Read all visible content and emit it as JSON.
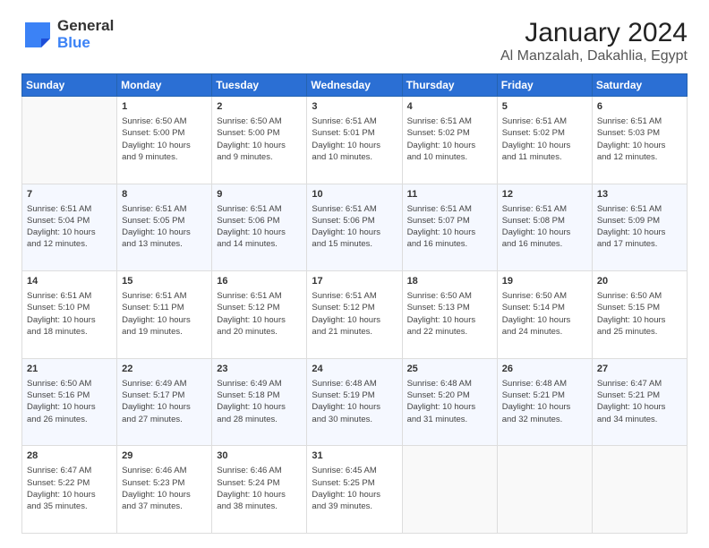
{
  "logo": {
    "general": "General",
    "blue": "Blue"
  },
  "title": "January 2024",
  "subtitle": "Al Manzalah, Dakahlia, Egypt",
  "days_of_week": [
    "Sunday",
    "Monday",
    "Tuesday",
    "Wednesday",
    "Thursday",
    "Friday",
    "Saturday"
  ],
  "weeks": [
    [
      {
        "day": "",
        "info": ""
      },
      {
        "day": "1",
        "info": "Sunrise: 6:50 AM\nSunset: 5:00 PM\nDaylight: 10 hours\nand 9 minutes."
      },
      {
        "day": "2",
        "info": "Sunrise: 6:50 AM\nSunset: 5:00 PM\nDaylight: 10 hours\nand 9 minutes."
      },
      {
        "day": "3",
        "info": "Sunrise: 6:51 AM\nSunset: 5:01 PM\nDaylight: 10 hours\nand 10 minutes."
      },
      {
        "day": "4",
        "info": "Sunrise: 6:51 AM\nSunset: 5:02 PM\nDaylight: 10 hours\nand 10 minutes."
      },
      {
        "day": "5",
        "info": "Sunrise: 6:51 AM\nSunset: 5:02 PM\nDaylight: 10 hours\nand 11 minutes."
      },
      {
        "day": "6",
        "info": "Sunrise: 6:51 AM\nSunset: 5:03 PM\nDaylight: 10 hours\nand 12 minutes."
      }
    ],
    [
      {
        "day": "7",
        "info": "Sunrise: 6:51 AM\nSunset: 5:04 PM\nDaylight: 10 hours\nand 12 minutes."
      },
      {
        "day": "8",
        "info": "Sunrise: 6:51 AM\nSunset: 5:05 PM\nDaylight: 10 hours\nand 13 minutes."
      },
      {
        "day": "9",
        "info": "Sunrise: 6:51 AM\nSunset: 5:06 PM\nDaylight: 10 hours\nand 14 minutes."
      },
      {
        "day": "10",
        "info": "Sunrise: 6:51 AM\nSunset: 5:06 PM\nDaylight: 10 hours\nand 15 minutes."
      },
      {
        "day": "11",
        "info": "Sunrise: 6:51 AM\nSunset: 5:07 PM\nDaylight: 10 hours\nand 16 minutes."
      },
      {
        "day": "12",
        "info": "Sunrise: 6:51 AM\nSunset: 5:08 PM\nDaylight: 10 hours\nand 16 minutes."
      },
      {
        "day": "13",
        "info": "Sunrise: 6:51 AM\nSunset: 5:09 PM\nDaylight: 10 hours\nand 17 minutes."
      }
    ],
    [
      {
        "day": "14",
        "info": "Sunrise: 6:51 AM\nSunset: 5:10 PM\nDaylight: 10 hours\nand 18 minutes."
      },
      {
        "day": "15",
        "info": "Sunrise: 6:51 AM\nSunset: 5:11 PM\nDaylight: 10 hours\nand 19 minutes."
      },
      {
        "day": "16",
        "info": "Sunrise: 6:51 AM\nSunset: 5:12 PM\nDaylight: 10 hours\nand 20 minutes."
      },
      {
        "day": "17",
        "info": "Sunrise: 6:51 AM\nSunset: 5:12 PM\nDaylight: 10 hours\nand 21 minutes."
      },
      {
        "day": "18",
        "info": "Sunrise: 6:50 AM\nSunset: 5:13 PM\nDaylight: 10 hours\nand 22 minutes."
      },
      {
        "day": "19",
        "info": "Sunrise: 6:50 AM\nSunset: 5:14 PM\nDaylight: 10 hours\nand 24 minutes."
      },
      {
        "day": "20",
        "info": "Sunrise: 6:50 AM\nSunset: 5:15 PM\nDaylight: 10 hours\nand 25 minutes."
      }
    ],
    [
      {
        "day": "21",
        "info": "Sunrise: 6:50 AM\nSunset: 5:16 PM\nDaylight: 10 hours\nand 26 minutes."
      },
      {
        "day": "22",
        "info": "Sunrise: 6:49 AM\nSunset: 5:17 PM\nDaylight: 10 hours\nand 27 minutes."
      },
      {
        "day": "23",
        "info": "Sunrise: 6:49 AM\nSunset: 5:18 PM\nDaylight: 10 hours\nand 28 minutes."
      },
      {
        "day": "24",
        "info": "Sunrise: 6:48 AM\nSunset: 5:19 PM\nDaylight: 10 hours\nand 30 minutes."
      },
      {
        "day": "25",
        "info": "Sunrise: 6:48 AM\nSunset: 5:20 PM\nDaylight: 10 hours\nand 31 minutes."
      },
      {
        "day": "26",
        "info": "Sunrise: 6:48 AM\nSunset: 5:21 PM\nDaylight: 10 hours\nand 32 minutes."
      },
      {
        "day": "27",
        "info": "Sunrise: 6:47 AM\nSunset: 5:21 PM\nDaylight: 10 hours\nand 34 minutes."
      }
    ],
    [
      {
        "day": "28",
        "info": "Sunrise: 6:47 AM\nSunset: 5:22 PM\nDaylight: 10 hours\nand 35 minutes."
      },
      {
        "day": "29",
        "info": "Sunrise: 6:46 AM\nSunset: 5:23 PM\nDaylight: 10 hours\nand 37 minutes."
      },
      {
        "day": "30",
        "info": "Sunrise: 6:46 AM\nSunset: 5:24 PM\nDaylight: 10 hours\nand 38 minutes."
      },
      {
        "day": "31",
        "info": "Sunrise: 6:45 AM\nSunset: 5:25 PM\nDaylight: 10 hours\nand 39 minutes."
      },
      {
        "day": "",
        "info": ""
      },
      {
        "day": "",
        "info": ""
      },
      {
        "day": "",
        "info": ""
      }
    ]
  ]
}
